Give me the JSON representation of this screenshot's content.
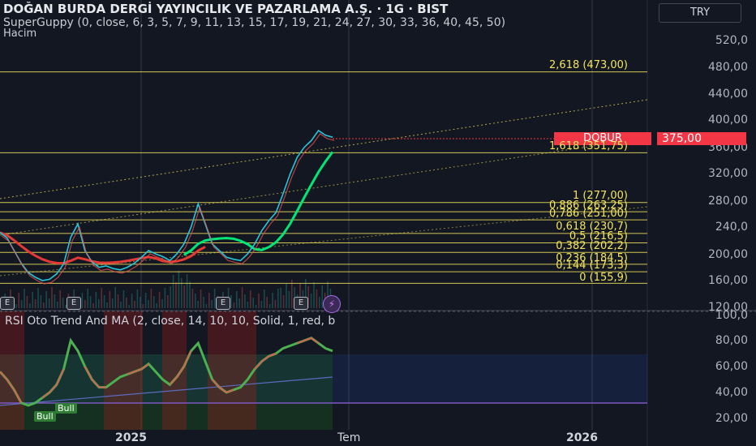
{
  "header": {
    "title": "DOĞAN BURDA DERGİ YAYINCILIK VE PAZARLAMA A.Ş. · 1G · BIST",
    "indicator": "SuperGuppy (0, close, 6, 3, 5, 7, 9, 11, 13, 15, 17, 19, 21, 24, 27, 30, 33, 36, 40, 45, 50)",
    "volume": "Hacim"
  },
  "currency": "TRY",
  "symbol_tag": "DOBUR",
  "last_price": "375,00",
  "price_axis": [
    "520,0",
    "480,00",
    "440,00",
    "400,00",
    "360,00",
    "320,00",
    "280,00",
    "240,0",
    "200,00",
    "160,00",
    "120,00"
  ],
  "rsi_axis": [
    "100,0",
    "80,00",
    "60,00",
    "40,00",
    "20,00"
  ],
  "rsi_title": "RSI Oto Trend And MA (2, close, 14, 10, 10, Solid, 1, red, b",
  "fib_levels": [
    {
      "label": "2,618 (473,00)",
      "value": 473.0
    },
    {
      "label": "1,618 (351,75)",
      "value": 351.75
    },
    {
      "label": "1 (277,00)",
      "value": 277.0
    },
    {
      "label": "0,886 (263,25)",
      "value": 263.25
    },
    {
      "label": "0,786 (251,00)",
      "value": 251.0
    },
    {
      "label": "0,618 (230,7)",
      "value": 230.7
    },
    {
      "label": "0,5 (216,5)",
      "value": 216.5
    },
    {
      "label": "0,382 (202,2)",
      "value": 202.2
    },
    {
      "label": "0,236 (184,5)",
      "value": 184.5
    },
    {
      "label": "0,144 (173,3)",
      "value": 173.3
    },
    {
      "label": "0 (155,9)",
      "value": 155.9
    }
  ],
  "time_axis": [
    {
      "label": "2025",
      "bold": true
    },
    {
      "label": "Tem",
      "bold": false
    },
    {
      "label": "2026",
      "bold": true
    }
  ],
  "earnings_marker": "E",
  "bull_labels": [
    "Bull",
    "Bull"
  ],
  "colors": {
    "background": "#131722",
    "up": "#26c6da",
    "down": "#ef5350",
    "fib": "#f3e55c",
    "guppy_fast": "#00e676",
    "guppy_slow": "#e53935",
    "price_tag": "#f23645"
  },
  "chart_data": [
    {
      "type": "line",
      "title": "DOĞAN BURDA DERGİ YAYINCILIK VE PAZARLAMA A.Ş.",
      "ylim": [
        120,
        540
      ],
      "series": [
        {
          "values": [
            232,
            224,
            205,
            186,
            172,
            165,
            160,
            162,
            170,
            185,
            225,
            245,
            205,
            188,
            180,
            182,
            178,
            176,
            180,
            186,
            195,
            205,
            200,
            196,
            190,
            200,
            215,
            240,
            275,
            245,
            215,
            205,
            195,
            192,
            190,
            200,
            215,
            235,
            250,
            262,
            290,
            320,
            345,
            360,
            370,
            385,
            378,
            375
          ]
        }
      ]
    },
    {
      "type": "line",
      "title": "RSI Oto Trend And MA",
      "ylim": [
        15,
        100
      ],
      "series": [
        {
          "values": [
            56,
            50,
            42,
            32,
            30,
            32,
            36,
            40,
            46,
            58,
            80,
            72,
            60,
            50,
            44,
            44,
            48,
            52,
            54,
            56,
            58,
            62,
            56,
            50,
            46,
            52,
            60,
            72,
            78,
            64,
            50,
            44,
            40,
            42,
            44,
            50,
            58,
            64,
            68,
            70,
            74,
            76,
            78,
            80,
            82,
            78,
            74,
            72
          ]
        }
      ]
    }
  ]
}
